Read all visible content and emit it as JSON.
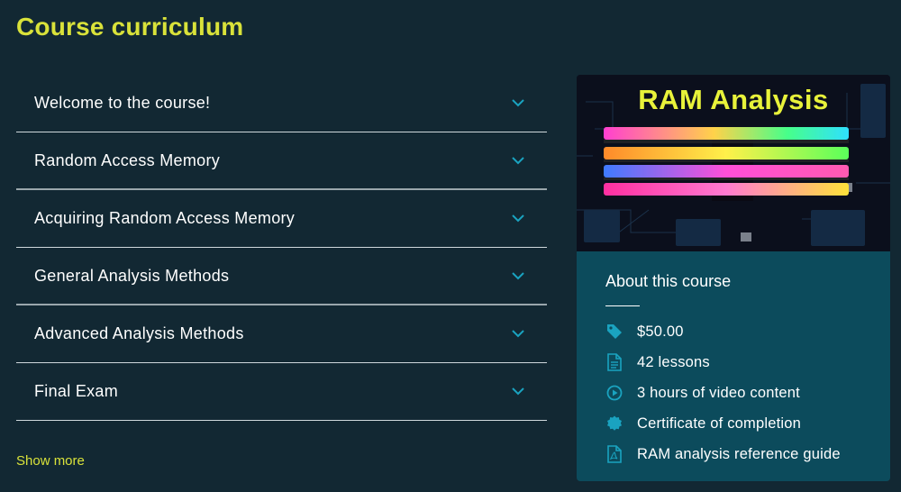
{
  "page": {
    "title": "Course curriculum"
  },
  "curriculum": {
    "sections": [
      {
        "label": "Welcome to the course!"
      },
      {
        "label": "Random Access Memory"
      },
      {
        "label": "Acquiring Random Access Memory"
      },
      {
        "label": "General Analysis Methods"
      },
      {
        "label": "Advanced Analysis Methods"
      },
      {
        "label": "Final Exam"
      }
    ],
    "show_more_label": "Show more"
  },
  "course_card": {
    "banner_title": "RAM Analysis",
    "about_heading": "About this course",
    "features": [
      {
        "icon": "price-tag-icon",
        "text": "$50.00"
      },
      {
        "icon": "document-icon",
        "text": "42 lessons"
      },
      {
        "icon": "play-circle-icon",
        "text": "3 hours of video content"
      },
      {
        "icon": "certificate-badge-icon",
        "text": "Certificate of completion"
      },
      {
        "icon": "pdf-file-icon",
        "text": "RAM analysis reference guide"
      }
    ]
  },
  "colors": {
    "background": "#122833",
    "accent": "#d9e23a",
    "card": "#0c4b5c",
    "icon": "#1aa3c0"
  }
}
